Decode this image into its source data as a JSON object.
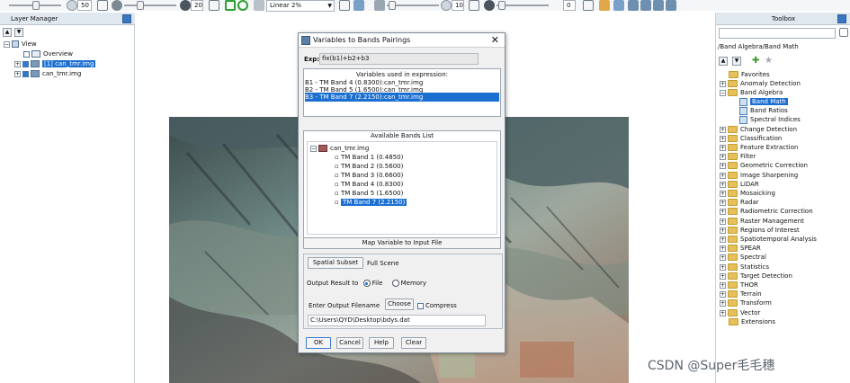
{
  "toolbar": {
    "slider1_value": "50",
    "slider2_value": "20",
    "stretch_selected": "Linear 2%",
    "slider3_value": "10",
    "slider4_value": "0"
  },
  "layer_manager": {
    "title": "Layer Manager",
    "items": [
      {
        "label": "View"
      },
      {
        "label": "Overview"
      },
      {
        "label": "[1] can_tmr.img"
      },
      {
        "label": "can_tmr.img"
      }
    ]
  },
  "toolbox": {
    "title": "Toolbox",
    "path": "/Band Algebra/Band Math",
    "items": [
      {
        "label": "Favorites"
      },
      {
        "label": "Anomaly Detection"
      },
      {
        "label": "Band Algebra"
      },
      {
        "label": "Band Math"
      },
      {
        "label": "Band Ratios"
      },
      {
        "label": "Spectral Indices"
      },
      {
        "label": "Change Detection"
      },
      {
        "label": "Classification"
      },
      {
        "label": "Feature Extraction"
      },
      {
        "label": "Filter"
      },
      {
        "label": "Geometric Correction"
      },
      {
        "label": "Image Sharpening"
      },
      {
        "label": "LiDAR"
      },
      {
        "label": "Mosaicking"
      },
      {
        "label": "Radar"
      },
      {
        "label": "Radiometric Correction"
      },
      {
        "label": "Raster Management"
      },
      {
        "label": "Regions of Interest"
      },
      {
        "label": "Spatiotemporal Analysis"
      },
      {
        "label": "SPEAR"
      },
      {
        "label": "Spectral"
      },
      {
        "label": "Statistics"
      },
      {
        "label": "Target Detection"
      },
      {
        "label": "THOR"
      },
      {
        "label": "Terrain"
      },
      {
        "label": "Transform"
      },
      {
        "label": "Vector"
      },
      {
        "label": "Extensions"
      }
    ]
  },
  "dialog": {
    "title": "Variables to Bands Pairings",
    "exp_label": "Exp:",
    "expression": "fix(b1)+b2+b3",
    "vars_header": "Variables used in expression:",
    "variables": [
      "B1 - TM Band 4 (0.8300):can_tmr.img",
      "B2 - TM Band 5 (1.6500):can_tmr.img",
      "B3 - TM Band 7 (2.2150):can_tmr.img"
    ],
    "bands_header": "Available Bands List",
    "file_name": "can_tmr.img",
    "bands": [
      "TM Band 1 (0.4850)",
      "TM Band 2 (0.5600)",
      "TM Band 3 (0.6600)",
      "TM Band 4 (0.8300)",
      "TM Band 5 (1.6500)",
      "TM Band 7 (2.2150)"
    ],
    "map_button": "Map Variable to Input File",
    "spatial_subset_button": "Spatial Subset",
    "spatial_subset_value": "Full Scene",
    "output_label": "Output Result to",
    "radio_file": "File",
    "radio_memory": "Memory",
    "filename_label": "Enter Output Filename",
    "choose_button": "Choose",
    "compress_label": "Compress",
    "output_path": "C:\\Users\\QYD\\Desktop\\bdys.dat",
    "ok": "OK",
    "cancel": "Cancel",
    "help": "Help",
    "clear": "Clear"
  },
  "watermark": "CSDN @Super毛毛穗",
  "colors": {
    "selection": "#1b6fd1",
    "panel_header": "#dfe7ef"
  }
}
